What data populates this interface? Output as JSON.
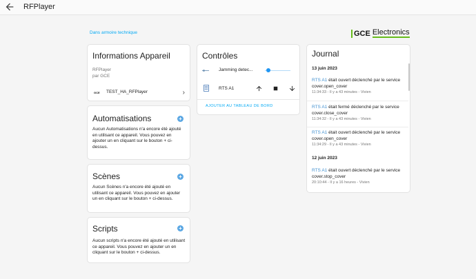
{
  "header": {
    "title": "RFPlayer"
  },
  "area_link": "Dans armoire technique",
  "logo": {
    "part1": "GCE",
    "part2": "Electronics"
  },
  "info": {
    "title": "Informations Appareil",
    "model": "RFPlayer",
    "manufacturer": "par GCE",
    "link_label": "TEST_HA_RFPlayer",
    "link_badge": "GCE"
  },
  "automations": {
    "title": "Automatisations",
    "text": "Aucun Automatisations n'a encore été ajouté en utilisant ce appareil. Vous pouvez en ajouter un en cliquant sur le bouton + ci-dessus."
  },
  "scenes": {
    "title": "Scènes",
    "text": "Aucun Scènes n'a encore été ajouté en utilisant ce appareil. Vous pouvez en ajouter un en cliquant sur le bouton + ci-dessus."
  },
  "scripts": {
    "title": "Scripts",
    "text": "Aucun scripts n'a encore été ajouté en utilisant ce appareil. Vous pouvez en ajouter un en cliquant sur le bouton + ci-dessus."
  },
  "controls": {
    "title": "Contrôles",
    "jamming_label": "Jamming detec...",
    "jamming_value": 0.05,
    "cover_label": "RTS A1",
    "add_label": "AJOUTER AU TABLEAU DE BORD"
  },
  "journal": {
    "title": "Journal",
    "groups": [
      {
        "date": "13 juin 2023",
        "entries": [
          {
            "entity": "RTS A1",
            "line1": " était ouvert déclenché par le service",
            "line2": "cover.open_cover",
            "meta": "11:34:33 - Il y a 43 minutes - Vivien"
          },
          {
            "entity": "RTS A1",
            "line1": " était fermé déclenché par le service",
            "line2": "cover.close_cover",
            "meta": "11:34:32 - Il y a 43 minutes - Vivien"
          },
          {
            "entity": "RTS A1",
            "line1": " était ouvert déclenché par le service",
            "line2": "cover.open_cover",
            "meta": "11:34:29 - Il y a 43 minutes - Vivien"
          }
        ]
      },
      {
        "date": "12 juin 2023",
        "entries": [
          {
            "entity": "RTS A1",
            "line1": " était ouvert déclenché par le service",
            "line2": "cover.stop_cover",
            "meta": "20:10:44 - Il y a 16 heures - Vivien"
          }
        ]
      }
    ]
  },
  "colors": {
    "accent": "#03a9f4",
    "plus": "#5ba7e3",
    "brand_green": "#66bb1a"
  }
}
